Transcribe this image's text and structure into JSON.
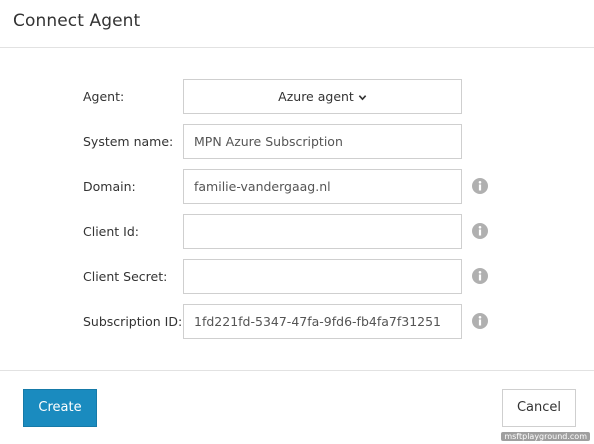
{
  "dialog": {
    "title": "Connect Agent"
  },
  "form": {
    "agent": {
      "label": "Agent:",
      "value": "Azure agent"
    },
    "system_name": {
      "label": "System name:",
      "value": "MPN Azure Subscription"
    },
    "domain": {
      "label": "Domain:",
      "value": "familie-vandergaag.nl"
    },
    "client_id": {
      "label": "Client Id:",
      "value": ""
    },
    "client_secret": {
      "label": "Client Secret:",
      "value": ""
    },
    "subscription_id": {
      "label": "Subscription ID:",
      "value": "1fd221fd-5347-47fa-9fd6-fb4fa7f31251"
    }
  },
  "footer": {
    "create_label": "Create",
    "cancel_label": "Cancel"
  },
  "watermark": "msftplayground.com",
  "colors": {
    "primary_button": "#1a8bbf",
    "info_icon": "#b0b0b0",
    "border": "#cfcfcf"
  },
  "icons": {
    "select_chevron": "chevron-down-icon",
    "info": "info-icon"
  }
}
